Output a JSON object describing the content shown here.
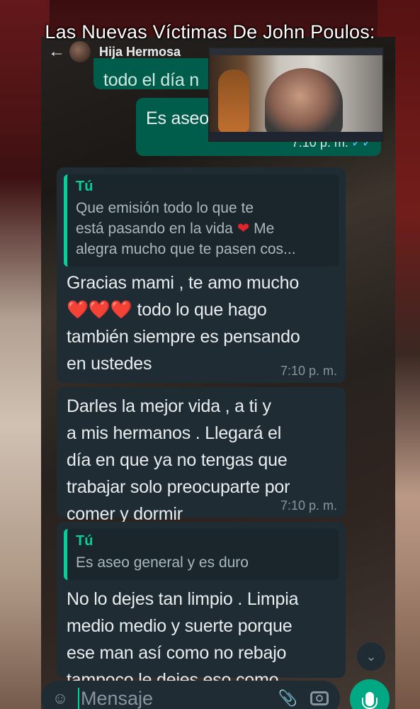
{
  "caption": "Las Nuevas Víctimas De John Poulos:",
  "header": {
    "contact_name": "Hija Hermosa"
  },
  "messages": [
    {
      "direction": "out",
      "partial_top": "todo el día n",
      "text": "Es aseo",
      "time": "7:10 p. m.",
      "status": "read"
    },
    {
      "direction": "in",
      "quote": {
        "author": "Tú",
        "line1": "Que emisión todo lo que te",
        "line2a": "está pasando en la vida",
        "line2b": "Me",
        "line3": "alegra mucho que te pasen cos..."
      },
      "line1": "Gracias mami , te amo mucho",
      "hearts": "❤️❤️❤️",
      "line2": "todo lo que hago",
      "line3": "también siempre es pensando",
      "line4": "en ustedes",
      "time": "7:10 p. m."
    },
    {
      "direction": "in",
      "line1": "Darles la mejor vida , a ti y",
      "line2": "a mis hermanos . Llegará el",
      "line3": "día en que ya no tengas que",
      "line4": "trabajar solo preocuparte por",
      "line5": "comer y dormir",
      "time": "7:10 p. m."
    },
    {
      "direction": "in",
      "quote": {
        "author": "Tú",
        "line1": "Es aseo general y es duro"
      },
      "line1": "No lo dejes tan limpio . Limpia",
      "line2": "medio medio y suerte porque",
      "line3": "ese man así como no rebajo",
      "line4": "tampoco le dejes eso como"
    }
  ],
  "input": {
    "placeholder": "Mensaje"
  },
  "icons": {
    "back": "arrow-left-icon",
    "emoji": "emoji-icon",
    "attach": "paperclip-icon",
    "camera": "camera-icon",
    "mic": "mic-icon",
    "scroll": "chevron-double-down-icon"
  },
  "colors": {
    "outgoing_bubble": "#005c4b",
    "incoming_bubble": "#1f2c34",
    "accent": "#00a884",
    "quote_author": "#06cf9c"
  }
}
